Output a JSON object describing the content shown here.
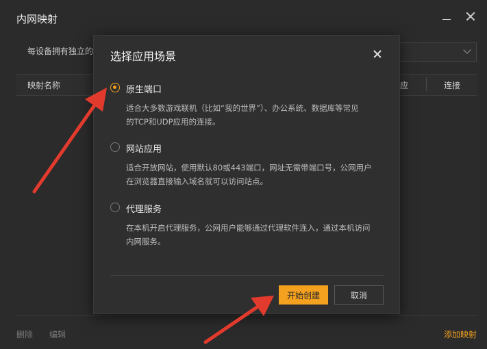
{
  "window": {
    "title": "内网映射",
    "minimize_icon": "minimize-icon",
    "close_icon": "close-icon"
  },
  "main": {
    "description_partial": "每设备拥有独立的",
    "select_value": "",
    "table_headers": {
      "name": "映射名称",
      "col_partial": "应",
      "connect": "连接"
    }
  },
  "footer": {
    "delete_label": "删除",
    "edit_label": "编辑",
    "add_label": "添加映射"
  },
  "dialog": {
    "title": "选择应用场景",
    "options": [
      {
        "label": "原生端口",
        "desc_line1": "适合大多数游戏联机（比如“我的世界”）、办公系统、数据库等常见",
        "desc_line2": "的TCP和UDP应用的连接。",
        "checked": true
      },
      {
        "label": "网站应用",
        "desc_line1": "适合开放网站，使用默认80或443端口，网址无需带端口号，公网用户",
        "desc_line2": "在浏览器直接输入域名就可以访问站点。",
        "checked": false
      },
      {
        "label": "代理服务",
        "desc_line1": "在本机开启代理服务，公网用户能够通过代理软件连入，通过本机访问",
        "desc_line2": "内网服务。",
        "checked": false
      }
    ],
    "primary_button": "开始创建",
    "cancel_button": "取消"
  },
  "colors": {
    "accent": "#f3a11e",
    "annotation_arrow": "#e23b2e",
    "background": "#2b2b2b",
    "dialog_bg": "#2f2f2f"
  }
}
